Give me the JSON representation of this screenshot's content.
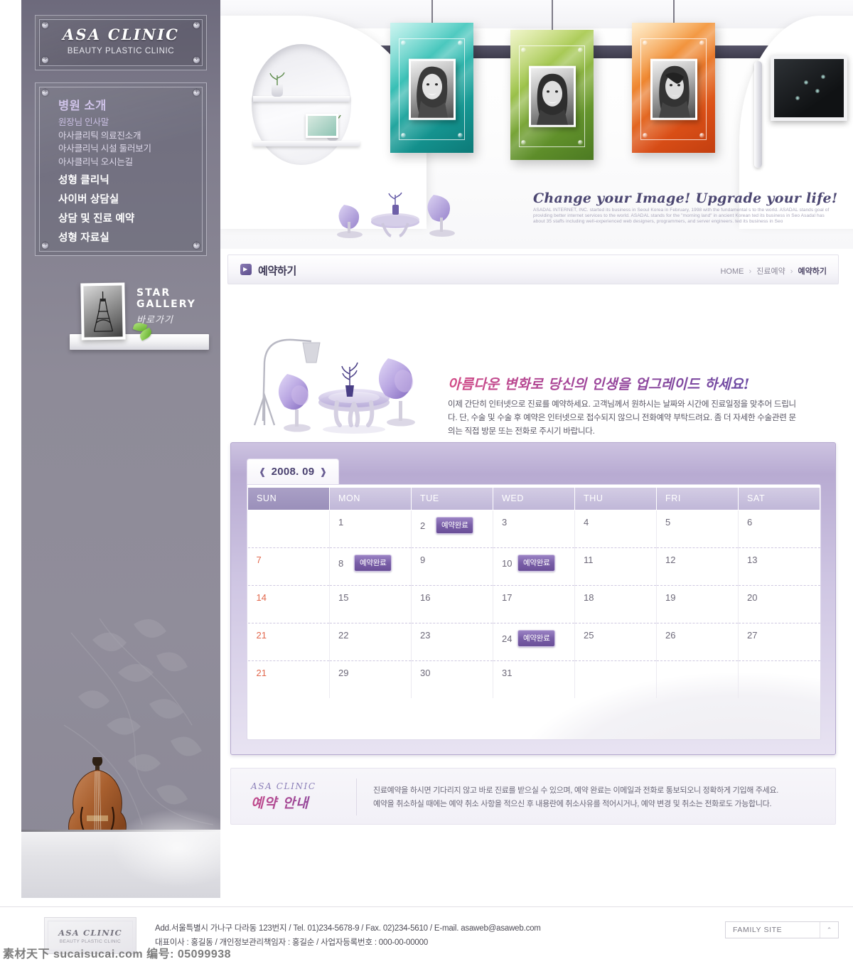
{
  "brand": {
    "name": "ASA CLINIC",
    "tagline_en": "BEAUTY PLASTIC CLINIC"
  },
  "sidebar": {
    "nav_heading": "병원 소개",
    "sub_items": [
      "원장님 인사말",
      "아사클리틱 의료진소개",
      "아사클리닉 시설 둘러보기",
      "아사클리닉 오시는길"
    ],
    "main_items": [
      "성형 클리닉",
      "사이버 상담실",
      "상담 및 진료 예약",
      "성형 자료실"
    ],
    "gallery": {
      "title_en": "STAR GALLERY",
      "title_kr": "바로가기"
    }
  },
  "banner": {
    "tagline": "Change your Image! Upgrade your life!",
    "body": "ASADAL INTERNET, INC. started its business in Seoul Korea in February, 1998 with the fundamental s to the world. ASADAL stands goal of providing better internet services to the world. ASADAL stands for the \"morning land\" in ancient Korean ted its business in Seo Asadal has about 35 staffs including well-experienced web designers, programmers, and server engineers. ted its business in Seo"
  },
  "breadcrumb": {
    "page_title": "예약하기",
    "home": "HOME",
    "section": "진료예약",
    "current": "예약하기"
  },
  "intro": {
    "heading": "아름다운 변화로 당신의 인생을 업그레이드 하세요!",
    "body": "이제 간단히 인터넷으로 진료를 예약하세요. 고객님께서 원하시는 날짜와 시간에 진료일정을 맞추어 드립니다. 단, 수술 및 수술 후 예약은 인터넷으로 접수되지 않으니 전화예약 부탁드려요. 좀 더 자세한 수술관련 문의는 직접 방문 또는 전화로 주시기 바랍니다."
  },
  "calendar": {
    "month_label": "2008. 09",
    "prev_arrow": "❰",
    "next_arrow": "❱",
    "badge_label": "예약완료",
    "weekdays": [
      "SUN",
      "MON",
      "TUE",
      "WED",
      "THU",
      "FRI",
      "SAT"
    ],
    "weeks": [
      [
        {
          "day": "",
          "badge": false
        },
        {
          "day": "1",
          "badge": false
        },
        {
          "day": "2",
          "badge": true
        },
        {
          "day": "3",
          "badge": false
        },
        {
          "day": "4",
          "badge": false
        },
        {
          "day": "5",
          "badge": false
        },
        {
          "day": "6",
          "badge": false
        }
      ],
      [
        {
          "day": "7",
          "badge": false
        },
        {
          "day": "8",
          "badge": true
        },
        {
          "day": "9",
          "badge": false
        },
        {
          "day": "10",
          "badge": true
        },
        {
          "day": "11",
          "badge": false
        },
        {
          "day": "12",
          "badge": false
        },
        {
          "day": "13",
          "badge": false
        }
      ],
      [
        {
          "day": "14",
          "badge": false
        },
        {
          "day": "15",
          "badge": false
        },
        {
          "day": "16",
          "badge": false
        },
        {
          "day": "17",
          "badge": false
        },
        {
          "day": "18",
          "badge": false
        },
        {
          "day": "19",
          "badge": false
        },
        {
          "day": "20",
          "badge": false
        }
      ],
      [
        {
          "day": "21",
          "badge": false
        },
        {
          "day": "22",
          "badge": false
        },
        {
          "day": "23",
          "badge": false
        },
        {
          "day": "24",
          "badge": true
        },
        {
          "day": "25",
          "badge": false
        },
        {
          "day": "26",
          "badge": false
        },
        {
          "day": "27",
          "badge": false
        }
      ],
      [
        {
          "day": "21",
          "badge": false
        },
        {
          "day": "29",
          "badge": false
        },
        {
          "day": "30",
          "badge": false
        },
        {
          "day": "31",
          "badge": false
        },
        {
          "day": "",
          "badge": false
        },
        {
          "day": "",
          "badge": false
        },
        {
          "day": "",
          "badge": false
        }
      ]
    ]
  },
  "notice": {
    "logo_en": "ASA CLINIC",
    "logo_kr": "예약 안내",
    "line1": "진료예약을 하시면 기다리지 않고 바로 진료를 받으실 수 있으며, 예약 완료는 이메일과 전화로 통보되오니 정확하게 기입해 주세요.",
    "line2": "예약을 취소하실 때에는 예약 취소 사항을 적으신 후 내용란에 취소사유를 적어시거나, 예약 변경 및 취소는 전화로도 가능합니다."
  },
  "footer": {
    "plate_title": "ASA CLINIC",
    "plate_sub": "BEAUTY PLASTIC CLINIC",
    "line1": "Add.서울특별시 가나구 다라동 123번지  /  Tel. 01)234-5678-9  /  Fax. 02)234-5610  /  E-mail. asaweb@asaweb.com",
    "line2": "대표이사 : 홍길동  /  개인정보관리책임자 : 홍길순  /  사업자등록번호 : 000-00-00000",
    "family_site": "FAMILY SITE",
    "family_chevron": "⌃"
  },
  "watermark": "素材天下 sucaisucai.com  编号: 05099938",
  "colors": {
    "sidebar": "#8d8a97",
    "accent_purple": "#6a4f98",
    "badge": "#7a5fa8",
    "sunday_red": "#e2674c",
    "frame_teal": "#2fb3ab",
    "frame_green": "#7ca832",
    "frame_orange": "#e2631f"
  }
}
